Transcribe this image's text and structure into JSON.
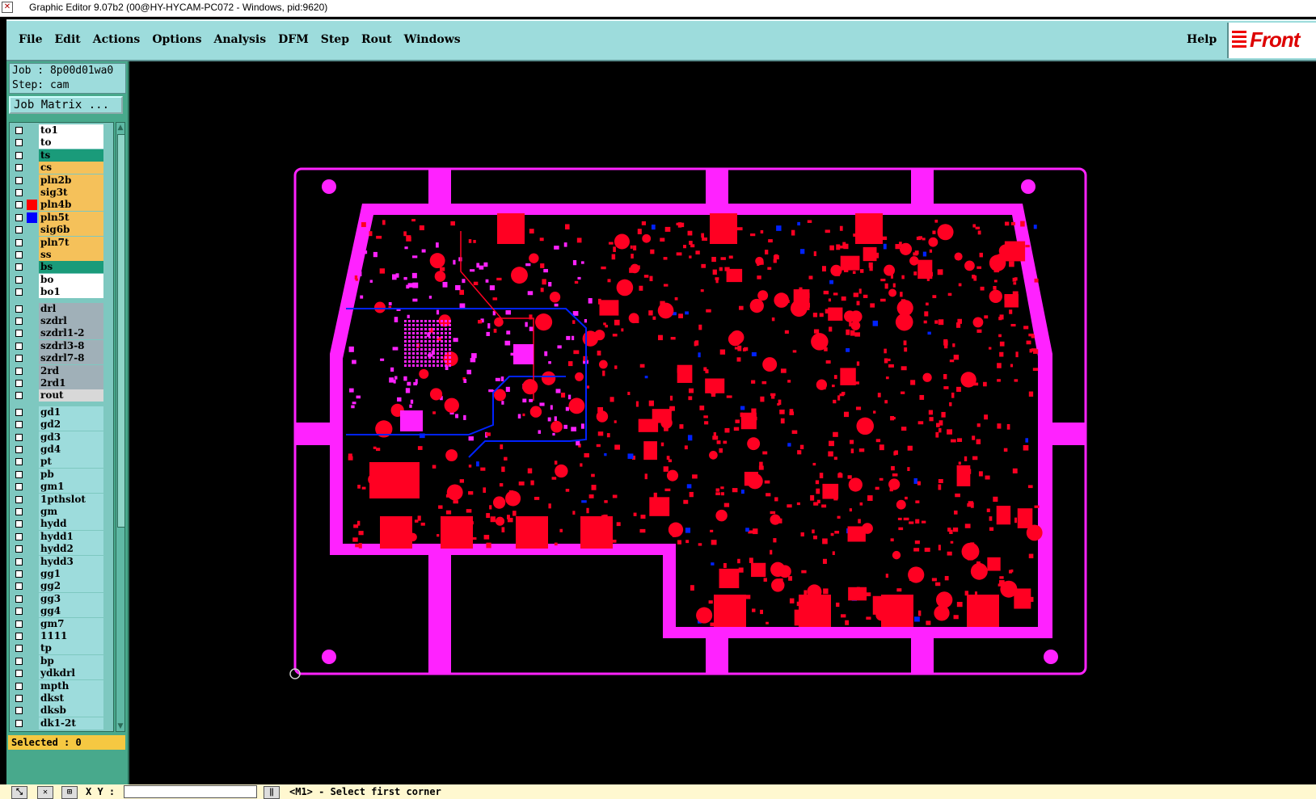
{
  "window": {
    "title": "Graphic Editor 9.07b2 (00@HY-HYCAM-PC072 - Windows, pid:9620)"
  },
  "menu": {
    "items": [
      "File",
      "Edit",
      "Actions",
      "Options",
      "Analysis",
      "DFM",
      "Step",
      "Rout",
      "Windows"
    ],
    "help": "Help",
    "logo_text": "Front"
  },
  "job": {
    "job_line": "Job : 8p00d01wa0",
    "step_line": "Step: cam",
    "matrix_button": "Job Matrix ..."
  },
  "layers": [
    {
      "name": "to1",
      "color": "#ffffff"
    },
    {
      "name": "to",
      "color": "#ffffff"
    },
    {
      "name": "ts",
      "color": "#1a9b7a"
    },
    {
      "name": "cs",
      "color": "#f5c15a"
    },
    {
      "name": "pln2b",
      "color": "#f5c15a"
    },
    {
      "name": "sig3t",
      "color": "#f5c15a"
    },
    {
      "name": "pln4b",
      "color": "#f5c15a",
      "swatch": "#ff0000"
    },
    {
      "name": "pln5t",
      "color": "#f5c15a",
      "swatch": "#0000ff"
    },
    {
      "name": "sig6b",
      "color": "#f5c15a"
    },
    {
      "name": "pln7t",
      "color": "#f5c15a"
    },
    {
      "name": "ss",
      "color": "#f5c15a"
    },
    {
      "name": "bs",
      "color": "#1a9b7a"
    },
    {
      "name": "bo",
      "color": "#ffffff"
    },
    {
      "name": "bo1",
      "color": "#ffffff"
    },
    {
      "name": "drl",
      "color": "#a0b0b8"
    },
    {
      "name": "szdrl",
      "color": "#a0b0b8"
    },
    {
      "name": "szdrl1-2",
      "color": "#a0b0b8"
    },
    {
      "name": "szdrl3-8",
      "color": "#a0b0b8"
    },
    {
      "name": "szdrl7-8",
      "color": "#a0b0b8"
    },
    {
      "name": "2rd",
      "color": "#a0b0b8"
    },
    {
      "name": "2rd1",
      "color": "#a0b0b8"
    },
    {
      "name": "rout",
      "color": "#d8d8d8"
    },
    {
      "name": "gd1",
      "color": "#9ddcdc"
    },
    {
      "name": "gd2",
      "color": "#9ddcdc"
    },
    {
      "name": "gd3",
      "color": "#9ddcdc"
    },
    {
      "name": "gd4",
      "color": "#9ddcdc"
    },
    {
      "name": "pt",
      "color": "#9ddcdc"
    },
    {
      "name": "pb",
      "color": "#9ddcdc"
    },
    {
      "name": "gm1",
      "color": "#9ddcdc"
    },
    {
      "name": "1pthslot",
      "color": "#9ddcdc"
    },
    {
      "name": "gm",
      "color": "#9ddcdc"
    },
    {
      "name": "hydd",
      "color": "#9ddcdc"
    },
    {
      "name": "hydd1",
      "color": "#9ddcdc"
    },
    {
      "name": "hydd2",
      "color": "#9ddcdc"
    },
    {
      "name": "hydd3",
      "color": "#9ddcdc"
    },
    {
      "name": "gg1",
      "color": "#9ddcdc"
    },
    {
      "name": "gg2",
      "color": "#9ddcdc"
    },
    {
      "name": "gg3",
      "color": "#9ddcdc"
    },
    {
      "name": "gg4",
      "color": "#9ddcdc"
    },
    {
      "name": "gm7",
      "color": "#9ddcdc"
    },
    {
      "name": "1111",
      "color": "#9ddcdc"
    },
    {
      "name": "tp",
      "color": "#9ddcdc"
    },
    {
      "name": "bp",
      "color": "#9ddcdc"
    },
    {
      "name": "ydkdrl",
      "color": "#9ddcdc"
    },
    {
      "name": "mpth",
      "color": "#9ddcdc"
    },
    {
      "name": "dkst",
      "color": "#9ddcdc"
    },
    {
      "name": "dksb",
      "color": "#9ddcdc"
    },
    {
      "name": "dk1-2t",
      "color": "#9ddcdc"
    }
  ],
  "selected": "Selected : 0",
  "status": {
    "xy_label": "X Y :",
    "xy_value": "",
    "message": "<M1> - Select first corner"
  },
  "colors": {
    "outline": "#ff22ff",
    "copper": "#ff0022",
    "blue_layer": "#0022ff"
  }
}
